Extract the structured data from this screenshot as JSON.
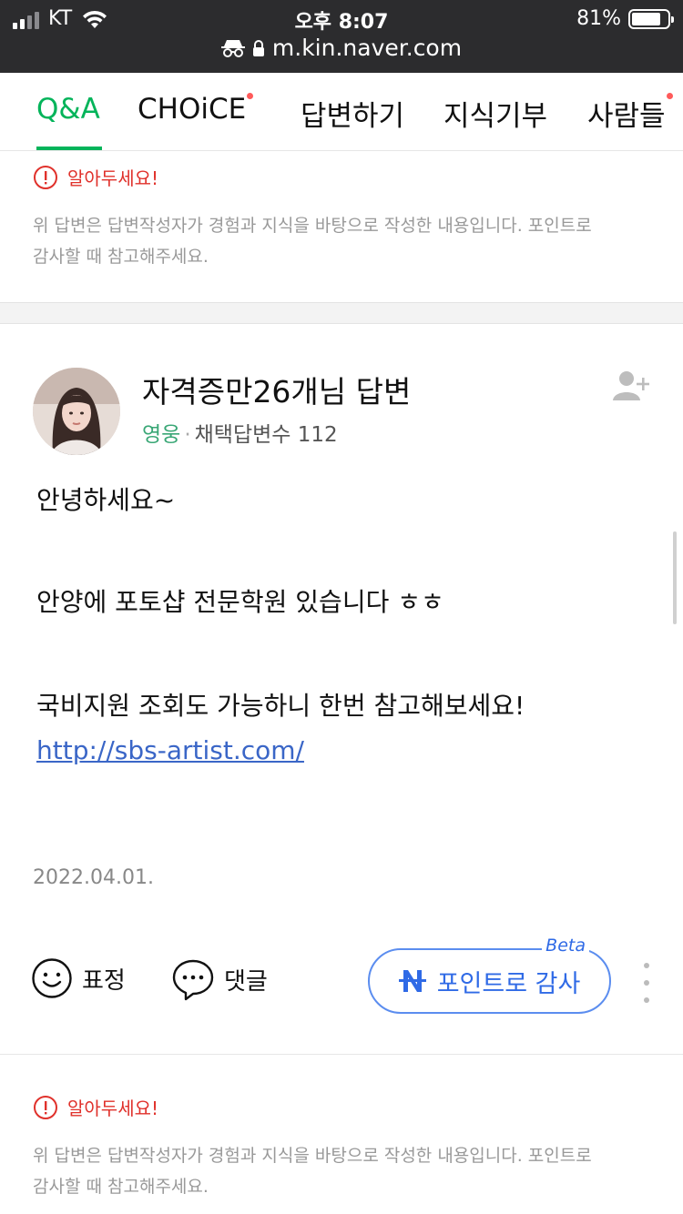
{
  "status": {
    "carrier": "KT",
    "time": "오후 8:07",
    "battery": "81%",
    "battery_level": 0.81,
    "url": "m.kin.naver.com"
  },
  "tabs": [
    {
      "label": "Q&A",
      "active": true,
      "dot": false
    },
    {
      "label": "CHOiCE",
      "active": false,
      "dot": true
    },
    {
      "label": "답변하기",
      "active": false,
      "dot": false
    },
    {
      "label": "지식기부",
      "active": false,
      "dot": false
    },
    {
      "label": "사람들",
      "active": false,
      "dot": true
    }
  ],
  "notice": {
    "title": "알아두세요!",
    "line1": "위 답변은 답변작성자가 경험과 지식을 바탕으로 작성한 내용입니다. 포인트로",
    "line2": "감사할 때 참고해주세요."
  },
  "answer": {
    "author_title": "자격증만26개님 답변",
    "grade": "영웅",
    "separator": "·",
    "adopted_label": "채택답변수",
    "adopted_count": "112",
    "greeting": "안녕하세요~",
    "line1": "안양에 포토샵 전문학원 있습니다 ㅎㅎ",
    "line2": "국비지원 조회도 가능하니 한번 참고해보세요!",
    "link": "http://sbs-artist.com/",
    "date": "2022.04.01."
  },
  "actions": {
    "emotion_label": "표정",
    "comment_label": "댓글",
    "thanks_label": "포인트로 감사",
    "beta_label": "Beta"
  },
  "colors": {
    "accent_green": "#03b45a",
    "warning_red": "#e0312b",
    "link_blue": "#3a66c7",
    "button_blue": "#2f6ae6"
  }
}
